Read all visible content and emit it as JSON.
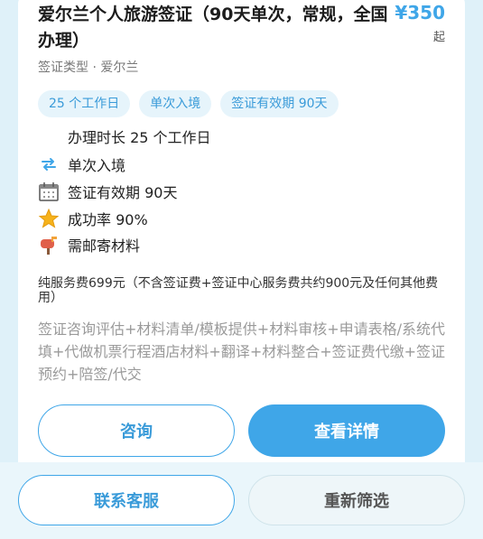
{
  "card": {
    "title": "爱尔兰个人旅游签证（90天单次，常规，全国办理）",
    "price": "¥350",
    "price_suffix": "起",
    "subtitle": "签证类型 · 爱尔兰",
    "tags": [
      "25 个工作日",
      "单次入境",
      "签证有效期 90天"
    ],
    "features": [
      {
        "icon": "clock-icon",
        "text": "办理时长 25 个工作日"
      },
      {
        "icon": "repeat-icon",
        "text": "单次入境"
      },
      {
        "icon": "calendar-icon",
        "text": "签证有效期 90天"
      },
      {
        "icon": "star-icon",
        "text": "成功率 90%"
      },
      {
        "icon": "mailbox-icon",
        "text": "需邮寄材料"
      }
    ],
    "fee_note": "纯服务费699元（不含签证费+签证中心服务费共约900元及任何其他费用）",
    "services": "签证咨询评估+材料清单/模板提供+材料审核+申请表格/系统代填+代做机票行程酒店材料+翻译+材料整合+签证费代缴+签证预约+陪签/代交",
    "consult_label": "咨询",
    "detail_label": "查看详情"
  },
  "bottom": {
    "contact_label": "联系客服",
    "refilter_label": "重新筛选"
  },
  "colors": {
    "accent": "#3fa6e8",
    "tag_bg": "#e6f4fb",
    "page_bg": "#dff1f9"
  }
}
